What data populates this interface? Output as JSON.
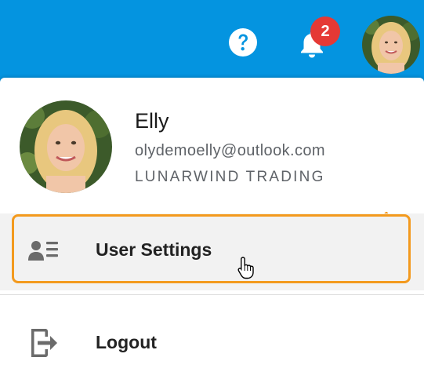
{
  "header": {
    "notification_count": "2",
    "icons": [
      "help-icon",
      "bell-icon",
      "user-avatar"
    ]
  },
  "profile": {
    "name": "Elly",
    "email": "olydemoelly@outlook.com",
    "company": "LUNARWIND TRADING"
  },
  "menu": {
    "items": [
      {
        "label": "User Settings",
        "icon": "user-settings-icon",
        "highlighted": true
      },
      {
        "label": "Logout",
        "icon": "logout-icon",
        "highlighted": false
      }
    ]
  },
  "colors": {
    "topbar": "#0494e0",
    "badge": "#e53935",
    "highlight": "#f39a1e",
    "hover_row": "#f2f2f2"
  }
}
